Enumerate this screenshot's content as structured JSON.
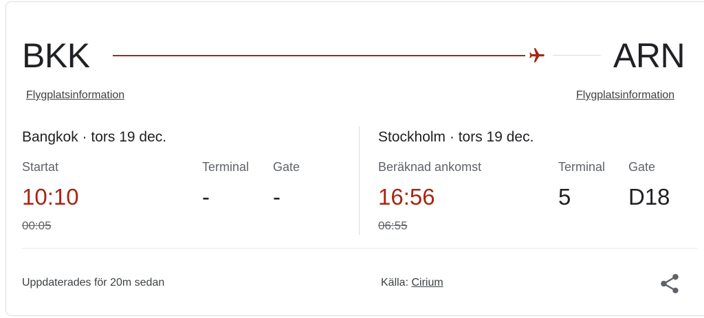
{
  "route": {
    "departure_code": "BKK",
    "arrival_code": "ARN",
    "airport_info_link": "Flygplatsinformation",
    "line_color": "#a52714"
  },
  "departure": {
    "header": "Bangkok · tors 19 dec.",
    "status_label": "Startat",
    "terminal_label": "Terminal",
    "gate_label": "Gate",
    "time": "10:10",
    "terminal": "-",
    "gate": "-",
    "scheduled_time": "00:05"
  },
  "arrival": {
    "header": "Stockholm · tors 19 dec.",
    "status_label": "Beräknad ankomst",
    "terminal_label": "Terminal",
    "gate_label": "Gate",
    "time": "16:56",
    "terminal": "5",
    "gate": "D18",
    "scheduled_time": "06:55"
  },
  "footer": {
    "updated": "Uppdaterades för 20m sedan",
    "source_label": "Källa:",
    "source_link": "Cirium"
  },
  "icons": {
    "plane": "airplane-icon",
    "share": "share-icon"
  },
  "colors": {
    "delayed_time": "#a52714",
    "text": "#202124",
    "muted": "#5f6368"
  }
}
